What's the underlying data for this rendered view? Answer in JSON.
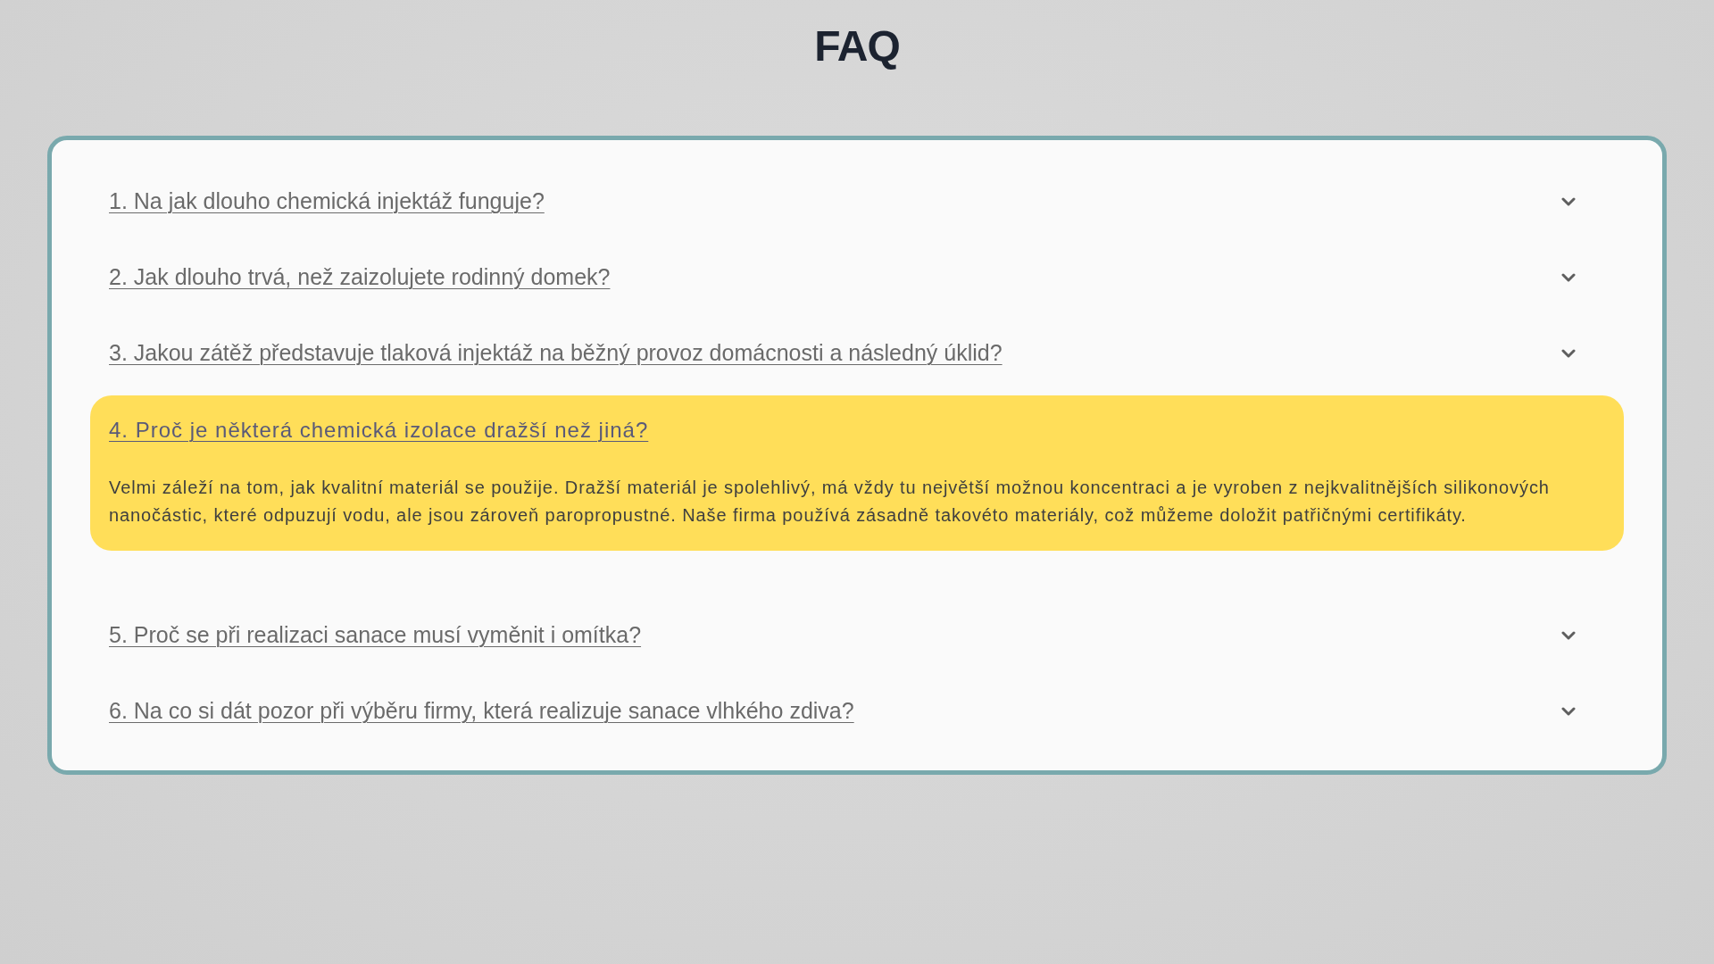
{
  "title": "FAQ",
  "items": [
    {
      "question": "1. Na jak dlouho chemická injektáž funguje?",
      "expanded": false
    },
    {
      "question": "2. Jak dlouho trvá, než zaizolujete rodinný domek?",
      "expanded": false
    },
    {
      "question": "3. Jakou zátěž představuje tlaková injektáž na běžný provoz domácnosti a následný úklid?",
      "expanded": false
    },
    {
      "question": "4. Proč je některá chemická izolace dražší než jiná?",
      "expanded": true,
      "answer": "Velmi záleží na tom, jak kvalitní materiál se použije. Dražší materiál je spolehlivý, má vždy tu největší možnou koncentraci a je vyroben z nejkvalitnějších silikonových nanočástic, které odpuzují vodu, ale jsou zároveň paropropustné. Naše firma používá zásadně takovéto materiály, což můžeme doložit patřičnými certifikáty."
    },
    {
      "question": "5. Proč se při realizaci sanace musí vyměnit i omítka?",
      "expanded": false
    },
    {
      "question": "6. Na co si dát pozor při výběru firmy, která realizuje sanace vlhkého zdiva?",
      "expanded": false
    }
  ]
}
